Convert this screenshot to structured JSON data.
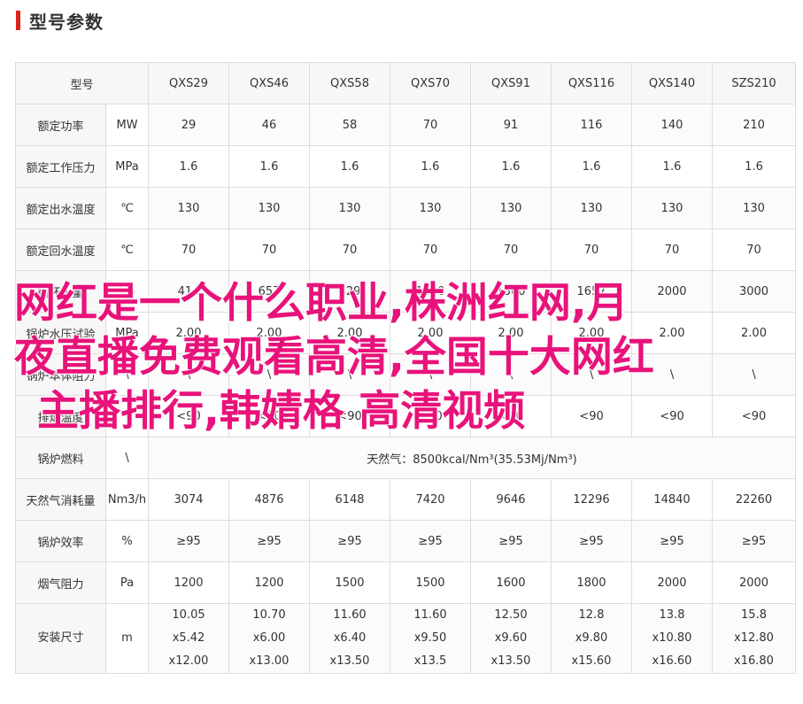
{
  "section": {
    "title": "型号参数"
  },
  "table": {
    "header": {
      "label": "型号",
      "models": [
        "QXS29",
        "QXS46",
        "QXS58",
        "QXS70",
        "QXS91",
        "QXS116",
        "QXS140",
        "SZS210"
      ]
    },
    "rows": [
      {
        "name": "额定功率",
        "unit": "MW",
        "values": [
          "29",
          "46",
          "58",
          "70",
          "91",
          "116",
          "140",
          "210"
        ]
      },
      {
        "name": "额定工作压力",
        "unit": "MPa",
        "values": [
          "1.6",
          "1.6",
          "1.6",
          "1.6",
          "1.6",
          "1.6",
          "1.6",
          "1.6"
        ]
      },
      {
        "name": "额定出水温度",
        "unit": "℃",
        "values": [
          "130",
          "130",
          "130",
          "130",
          "130",
          "130",
          "130",
          "130"
        ]
      },
      {
        "name": "额定回水温度",
        "unit": "℃",
        "values": [
          "70",
          "70",
          "70",
          "70",
          "70",
          "70",
          "70",
          "70"
        ]
      },
      {
        "name": "循环水量",
        "unit": "t/h",
        "values": [
          "414",
          "657",
          "829",
          "1000",
          "1300",
          "1657",
          "2000",
          "3000"
        ]
      },
      {
        "name": "锅炉水压试验",
        "unit": "MPa",
        "values": [
          "2.00",
          "2.00",
          "2.00",
          "2.00",
          "2.00",
          "2.00",
          "2.00",
          "2.00"
        ]
      },
      {
        "name": "锅炉本体阻力",
        "unit": "\\",
        "values": [
          "\\",
          "\\",
          "\\",
          "\\",
          "\\",
          "\\",
          "\\",
          "\\"
        ]
      },
      {
        "name": "排烟温度",
        "unit": "℃",
        "values": [
          "<90",
          "<90",
          "<90",
          "<90",
          "<90",
          "<90",
          "<90",
          "<90"
        ]
      }
    ],
    "fuel_row": {
      "name": "锅炉燃料",
      "unit": "\\",
      "value": "天然气：8500kcal/Nm³(35.53Mj/Nm³)"
    },
    "rows2": [
      {
        "name": "天然气消耗量",
        "unit": "Nm3/h",
        "values": [
          "3074",
          "4876",
          "6148",
          "7420",
          "9646",
          "12296",
          "14840",
          "22260"
        ]
      },
      {
        "name": "锅炉效率",
        "unit": "%",
        "values": [
          "≥95",
          "≥95",
          "≥95",
          "≥95",
          "≥95",
          "≥95",
          "≥95",
          "≥95"
        ]
      },
      {
        "name": "烟气阻力",
        "unit": "Pa",
        "values": [
          "1200",
          "1200",
          "1500",
          "1500",
          "1600",
          "1800",
          "2000",
          "2000"
        ]
      }
    ],
    "size_row": {
      "name": "安装尺寸",
      "unit": "m",
      "values": [
        [
          "10.05",
          "x5.42",
          "x12.00"
        ],
        [
          "10.70",
          "x6.00",
          "x13.00"
        ],
        [
          "11.60",
          "x6.40",
          "x13.50"
        ],
        [
          "11.60",
          "x9.50",
          "x13.5"
        ],
        [
          "12.50",
          "x9.60",
          "x13.50"
        ],
        [
          "12.8",
          "x9.80",
          "x15.60"
        ],
        [
          "13.8",
          "x10.80",
          "x16.60"
        ],
        [
          "15.8",
          "x12.80",
          "x16.80"
        ]
      ]
    }
  },
  "overlay": {
    "lines": [
      "网红是一个什么职业,株洲红网,月",
      "夜直播免费观看高清,全国十大网红",
      "主播排行,韩婧格  高清视频"
    ],
    "color": "#e8137a"
  }
}
